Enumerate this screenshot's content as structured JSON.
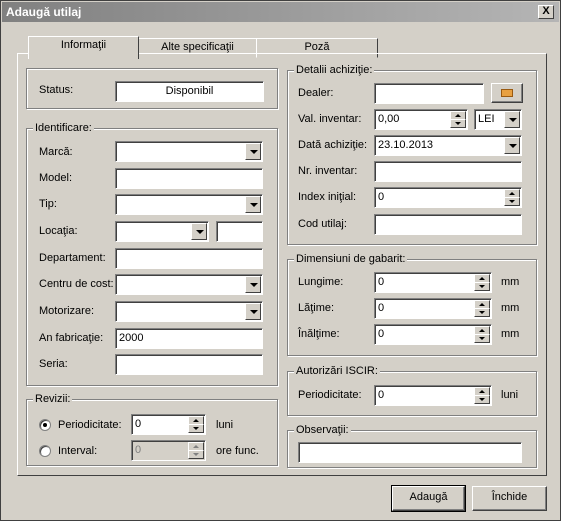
{
  "window": {
    "title": "Adaugă utilaj",
    "close": "X"
  },
  "tabs": [
    "Informaţii",
    "Alte specificaţii",
    "Poză"
  ],
  "status": {
    "label": "Status:",
    "value": "Disponibil"
  },
  "identificare": {
    "title": "Identificare:",
    "marca": "Marcă:",
    "model": "Model:",
    "tip": "Tip:",
    "locatia": "Locaţia:",
    "departament": "Departament:",
    "centru": "Centru de cost:",
    "motorizare": "Motorizare:",
    "an_label": "An fabricaţie:",
    "an_value": "2000",
    "seria": "Seria:"
  },
  "revizii": {
    "title": "Revizii:",
    "periodicitate_label": "Periodicitate:",
    "periodicitate_value": "0",
    "periodicitate_unit": "luni",
    "interval_label": "Interval:",
    "interval_value": "0",
    "interval_unit": "ore func."
  },
  "achizitie": {
    "title": "Detalii achiziţie:",
    "dealer": "Dealer:",
    "val_label": "Val. inventar:",
    "val_value": "0,00",
    "currency": "LEI",
    "data_label": "Dată achiziţie:",
    "data_value": "23.10.2013",
    "nr_inventar": "Nr. inventar:",
    "index_label": "Index iniţial:",
    "index_value": "0",
    "cod": "Cod utilaj:"
  },
  "dimensiuni": {
    "title": "Dimensiuni de gabarit:",
    "lungime_label": "Lungime:",
    "lungime_value": "0",
    "latime_label": "Lăţime:",
    "latime_value": "0",
    "inaltime_label": "Înălţime:",
    "inaltime_value": "0",
    "unit": "mm"
  },
  "iscir": {
    "title": "Autorizări ISCIR:",
    "label": "Periodicitate:",
    "value": "0",
    "unit": "luni"
  },
  "observatii": {
    "title": "Observaţii:"
  },
  "buttons": {
    "add": "Adaugă",
    "close": "Închide"
  }
}
